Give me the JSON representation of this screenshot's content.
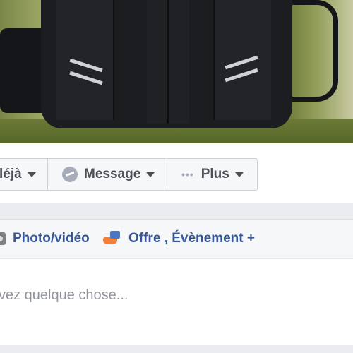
{
  "cover": {},
  "profile_actions": {
    "friends_label": "léjà",
    "message_label": "Message",
    "more_label": "Plus"
  },
  "composer": {
    "photo_video_label": "Photo/vidéo",
    "offer_event_label": "Offre , Évènement +",
    "placeholder": "vez quelque chose..."
  },
  "colors": {
    "link_blue": "#365899",
    "button_text": "#4b4f56",
    "placeholder_grey": "#90949c",
    "page_bg": "#e9ebee"
  }
}
